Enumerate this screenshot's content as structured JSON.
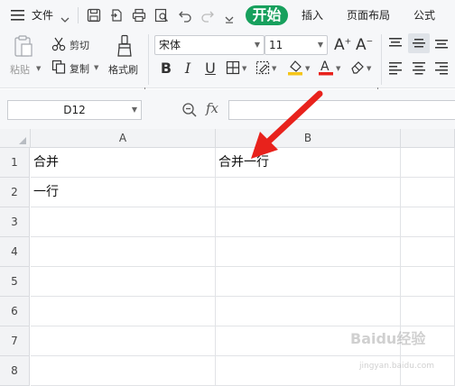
{
  "menubar": {
    "file_label": "文件",
    "tabs": [
      "开始",
      "插入",
      "页面布局",
      "公式"
    ]
  },
  "ribbon": {
    "paste_label": "粘贴",
    "cut_label": "剪切",
    "copy_label": "复制",
    "format_painter_label": "格式刷",
    "font_name": "宋体",
    "font_size": "11"
  },
  "formulabar": {
    "cell_ref": "D12",
    "fx_label": "fx"
  },
  "grid": {
    "columns": [
      "A",
      "B"
    ],
    "rows": [
      "1",
      "2",
      "3",
      "4",
      "5",
      "6",
      "7",
      "8"
    ],
    "cells": {
      "A1": "合并",
      "B1": "合并一行",
      "A2": "一行"
    }
  },
  "colors": {
    "accent": "#17a05d",
    "arrow": "#e8221c",
    "font_color_bar": "#e8221c",
    "fill_color_bar": "#f5c518"
  },
  "watermark": {
    "main": "Baidu经验",
    "sub": "jingyan.baidu.com"
  }
}
